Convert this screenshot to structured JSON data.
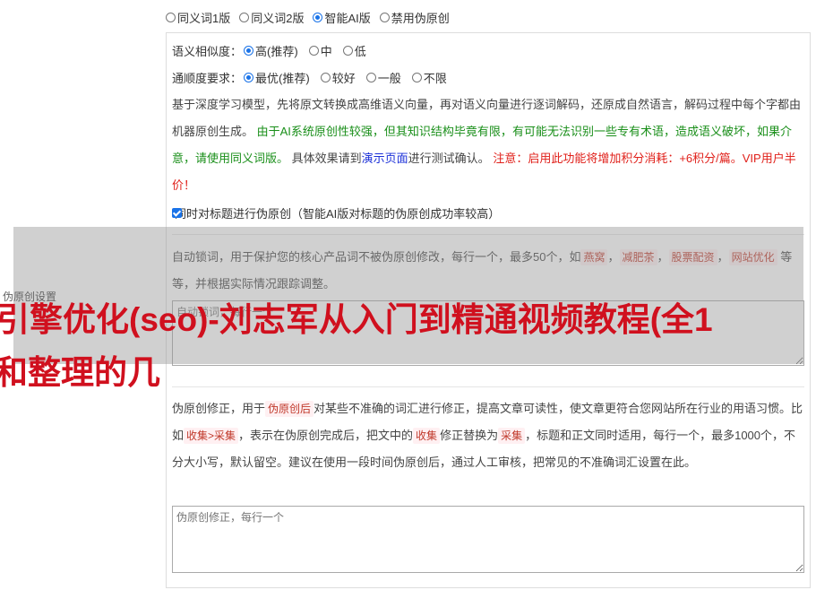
{
  "mode": {
    "options": [
      "同义词1版",
      "同义词2版",
      "智能AI版",
      "禁用伪原创"
    ],
    "selected": 2
  },
  "similarity": {
    "label": "语义相似度：",
    "options": [
      "高(推荐)",
      "中",
      "低"
    ],
    "selected": 0
  },
  "fluency": {
    "label": "通顺度要求：",
    "options": [
      "最优(推荐)",
      "较好",
      "一般",
      "不限"
    ],
    "selected": 0
  },
  "description": {
    "p1": "基于深度学习模型，先将原文转换成高维语义向量，再对语义向量进行逐词解码，还原成自然语言，解码过程中每个字都由机器原创生成。",
    "p2_green_a": "由于AI系统原创性较强，但其知识结构毕竟有限，",
    "p2_green_b": "有可能无法识别一些专有术语，造成语义破坏，如果介意，请使用同义词版。",
    "p3_pre": "具体效果请到",
    "p3_link": "演示页面",
    "p3_post": "进行测试确认。",
    "p4_red": "注意：启用此功能将增加积分消耗：+6积分/篇。VIP用户半价！"
  },
  "title_checkbox": {
    "label": "同时对标题进行伪原创（智能AI版对标题的伪原创成功率较高）",
    "checked": true
  },
  "lock": {
    "text_pre": "自动锁词，用于保护您的核心产品词不被伪原创修改，每行一个，最多50个，如",
    "tags": [
      "燕窝",
      "减肥茶",
      "股票配资",
      "网站优化"
    ],
    "text_post": "等等，并根据实际情况跟踪调整。",
    "placeholder": "自动锁词，每行一个"
  },
  "correction": {
    "text_a": "伪原创修正，用于",
    "tag_a": "伪原创后",
    "text_b": "对某些不准确的词汇进行修正，提高文章可读性，使文章更符合您网站所在行业的用语习惯。比如",
    "tag_b": "收集>采集",
    "text_c": "，表示在伪原创完成后，把文中的",
    "tag_c": "收集",
    "text_d": "修正替换为",
    "tag_d": "采集",
    "text_e": "，标题和正文同时适用，每行一个，最多1000个，不分大小写，默认留空。建议在使用一段时间伪原创后，通过人工审核，把常见的不准确词汇设置在此。",
    "placeholder": "伪原创修正，每行一个"
  },
  "side_label": "伪原创设置",
  "banner_line1": "引擎优化(seo)-刘志军从入门到精通视频教程(全1",
  "banner_line2": "和整理的几",
  "colors": {
    "accent": "#1a73e8",
    "banner": "#d0101e",
    "green": "#1a8f1a",
    "red": "#e0201a",
    "link": "#1a2fd8"
  }
}
